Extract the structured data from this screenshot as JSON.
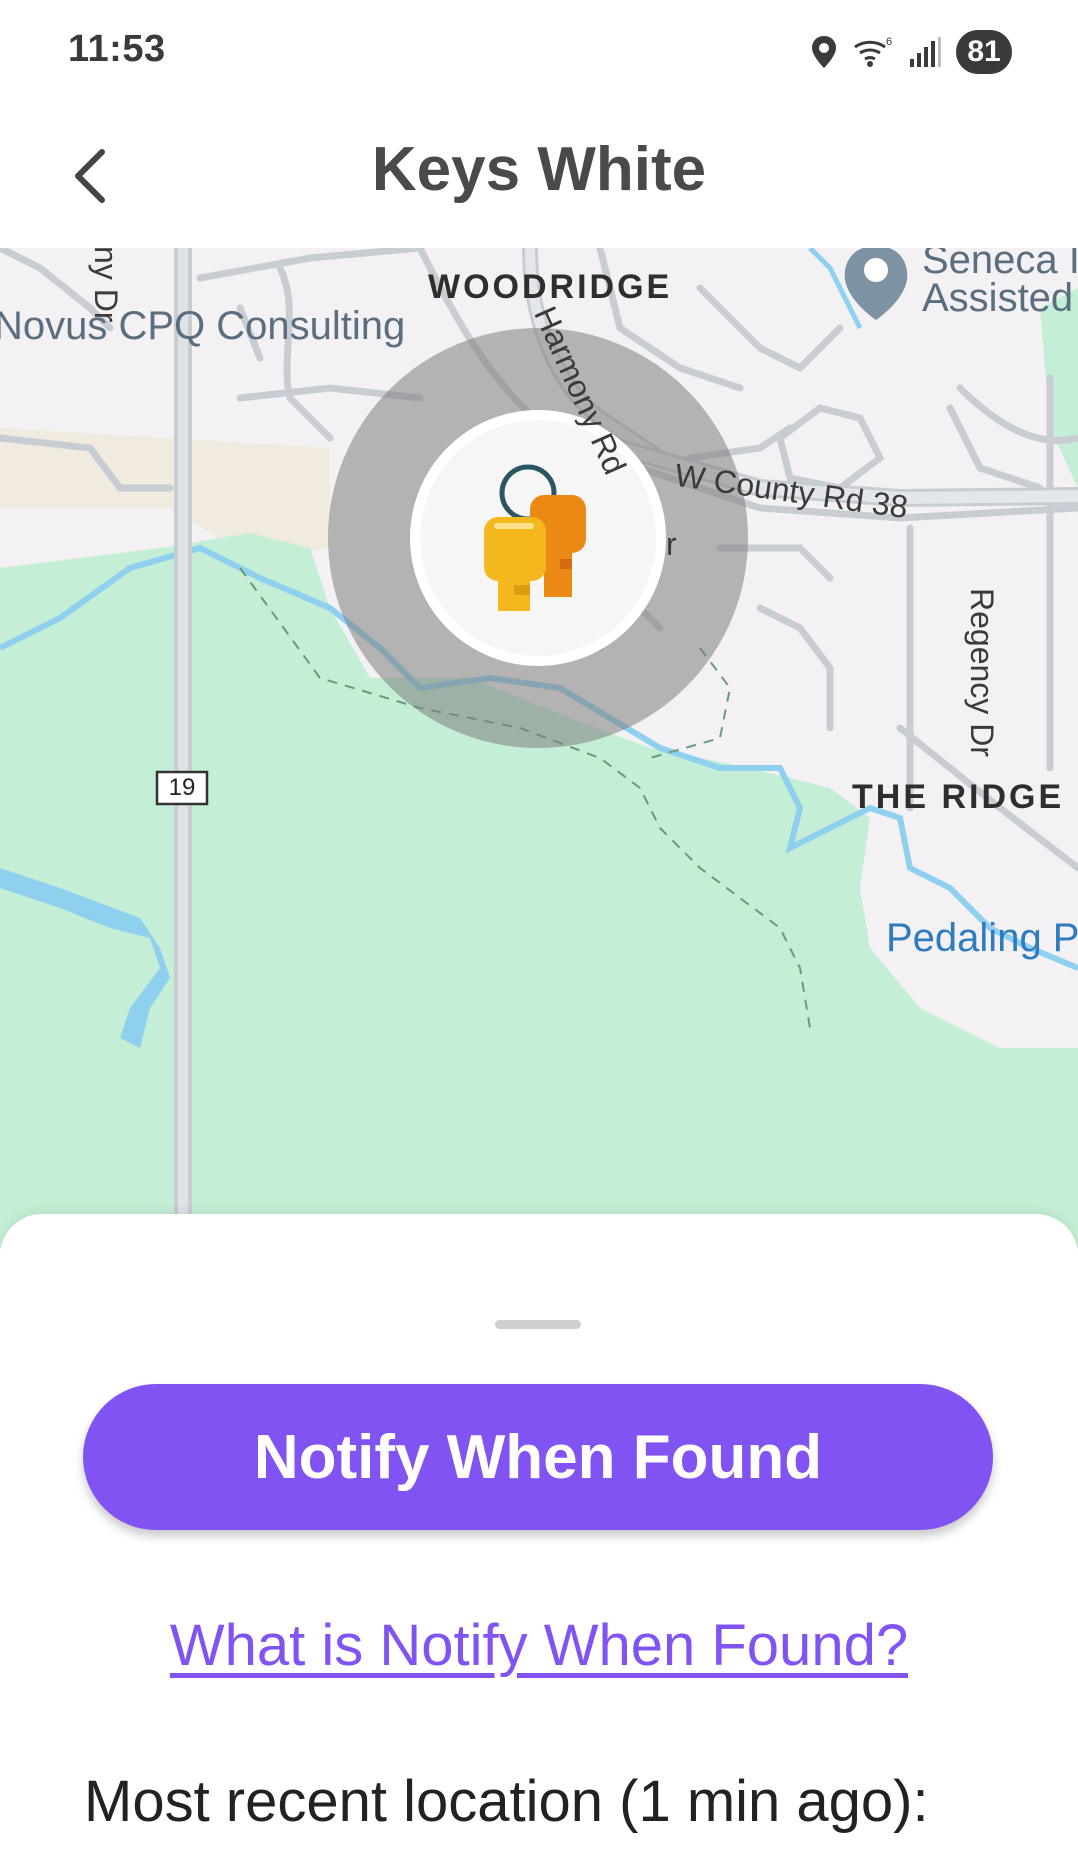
{
  "status_bar": {
    "time": "11:53",
    "battery": "81",
    "icons": [
      "location-icon",
      "wifi-icon",
      "signal-icon",
      "battery-icon"
    ]
  },
  "header": {
    "title": "Keys White",
    "back_icon": "chevron-left-icon"
  },
  "map": {
    "labels": {
      "area_woodridge": "WOODRIDGE",
      "area_the_ridge": "THE RIDGE",
      "poi_novus": "Novus CPQ Consulting",
      "poi_seneca_line1": "Seneca I",
      "poi_seneca_line2": "Assisted",
      "street_harmony": "Harmony Rd",
      "street_county": "W County Rd 38",
      "street_regency": "Regency Dr",
      "street_ny": "ny Dr",
      "street_r": "r",
      "park_pedaling": "Pedaling P",
      "route_shield": "19"
    },
    "device_icon": "keys-icon",
    "colors": {
      "land": "#f3f1f4",
      "park": "#c4eed5",
      "water": "#8fd0ef",
      "accuracy_circle": "#7f7f7f"
    }
  },
  "bottom_sheet": {
    "notify_button_label": "Notify When Found",
    "help_link": "What is Notify When Found?",
    "recent_location_label": "Most recent location (1 min ago):"
  },
  "colors": {
    "accent": "#8153f2",
    "title": "#4a4a4a"
  }
}
